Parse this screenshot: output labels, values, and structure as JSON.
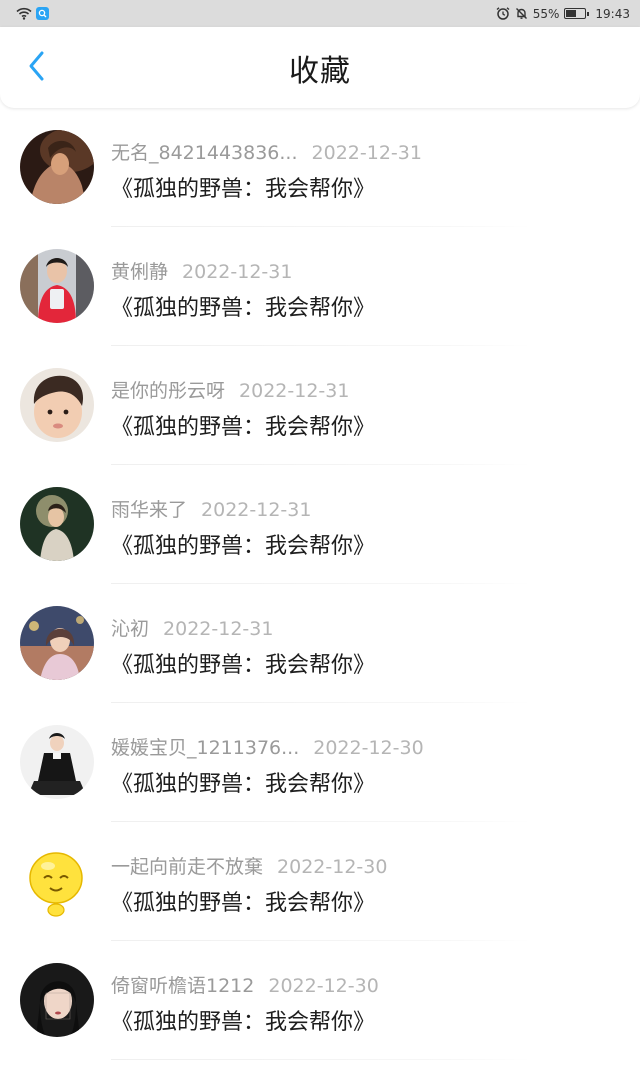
{
  "status_bar": {
    "battery_text": "55%",
    "time": "19:43",
    "battery_level": 0.55
  },
  "header": {
    "title": "收藏"
  },
  "items": [
    {
      "username": "无名_8421443836...",
      "date": "2022-12-31",
      "content": "《孤独的野兽：我会帮你》"
    },
    {
      "username": "黄俐静",
      "date": "2022-12-31",
      "content": "《孤独的野兽：我会帮你》"
    },
    {
      "username": "是你的彤云呀",
      "date": "2022-12-31",
      "content": "《孤独的野兽：我会帮你》"
    },
    {
      "username": "雨华来了",
      "date": "2022-12-31",
      "content": "《孤独的野兽：我会帮你》"
    },
    {
      "username": "沁初",
      "date": "2022-12-31",
      "content": "《孤独的野兽：我会帮你》"
    },
    {
      "username": "媛媛宝贝_1211376...",
      "date": "2022-12-30",
      "content": "《孤独的野兽：我会帮你》"
    },
    {
      "username": "一起向前走不放棄",
      "date": "2022-12-30",
      "content": "《孤独的野兽：我会帮你》"
    },
    {
      "username": "倚窗听檐语1212",
      "date": "2022-12-30",
      "content": "《孤独的野兽：我会帮你》"
    }
  ],
  "colors": {
    "accent": "#2aa4f4",
    "status_bar_bg": "#dcdcdc"
  }
}
